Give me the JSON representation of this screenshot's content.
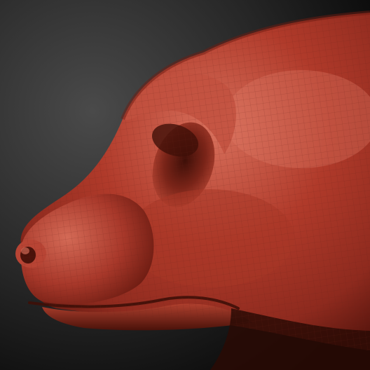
{
  "viewport": {
    "mode": "sculpt-preview",
    "subject": "animal-snout-model",
    "material": "red-clay",
    "wireframe_overlay": true
  },
  "colors": {
    "background_top": "#4a4a4a",
    "background_bottom": "#050505",
    "clay_highlight": "#e07a68",
    "clay_base": "#b03a2a",
    "clay_mid": "#8e2a1e",
    "clay_shadow": "#3e0f08",
    "wire": "#6a2218"
  }
}
